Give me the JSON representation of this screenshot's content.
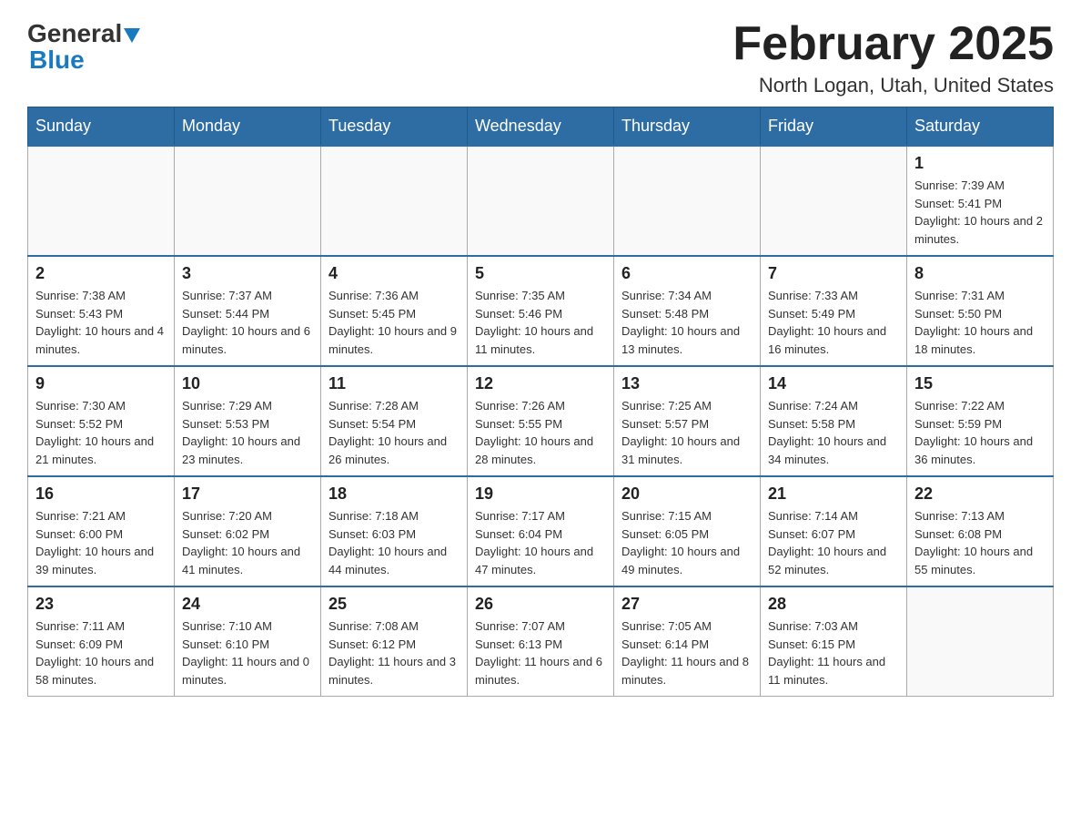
{
  "header": {
    "logo_general": "General",
    "logo_blue": "Blue",
    "month_title": "February 2025",
    "location": "North Logan, Utah, United States"
  },
  "days_of_week": [
    "Sunday",
    "Monday",
    "Tuesday",
    "Wednesday",
    "Thursday",
    "Friday",
    "Saturday"
  ],
  "weeks": [
    {
      "days": [
        {
          "number": "",
          "info": ""
        },
        {
          "number": "",
          "info": ""
        },
        {
          "number": "",
          "info": ""
        },
        {
          "number": "",
          "info": ""
        },
        {
          "number": "",
          "info": ""
        },
        {
          "number": "",
          "info": ""
        },
        {
          "number": "1",
          "info": "Sunrise: 7:39 AM\nSunset: 5:41 PM\nDaylight: 10 hours and 2 minutes."
        }
      ]
    },
    {
      "days": [
        {
          "number": "2",
          "info": "Sunrise: 7:38 AM\nSunset: 5:43 PM\nDaylight: 10 hours and 4 minutes."
        },
        {
          "number": "3",
          "info": "Sunrise: 7:37 AM\nSunset: 5:44 PM\nDaylight: 10 hours and 6 minutes."
        },
        {
          "number": "4",
          "info": "Sunrise: 7:36 AM\nSunset: 5:45 PM\nDaylight: 10 hours and 9 minutes."
        },
        {
          "number": "5",
          "info": "Sunrise: 7:35 AM\nSunset: 5:46 PM\nDaylight: 10 hours and 11 minutes."
        },
        {
          "number": "6",
          "info": "Sunrise: 7:34 AM\nSunset: 5:48 PM\nDaylight: 10 hours and 13 minutes."
        },
        {
          "number": "7",
          "info": "Sunrise: 7:33 AM\nSunset: 5:49 PM\nDaylight: 10 hours and 16 minutes."
        },
        {
          "number": "8",
          "info": "Sunrise: 7:31 AM\nSunset: 5:50 PM\nDaylight: 10 hours and 18 minutes."
        }
      ]
    },
    {
      "days": [
        {
          "number": "9",
          "info": "Sunrise: 7:30 AM\nSunset: 5:52 PM\nDaylight: 10 hours and 21 minutes."
        },
        {
          "number": "10",
          "info": "Sunrise: 7:29 AM\nSunset: 5:53 PM\nDaylight: 10 hours and 23 minutes."
        },
        {
          "number": "11",
          "info": "Sunrise: 7:28 AM\nSunset: 5:54 PM\nDaylight: 10 hours and 26 minutes."
        },
        {
          "number": "12",
          "info": "Sunrise: 7:26 AM\nSunset: 5:55 PM\nDaylight: 10 hours and 28 minutes."
        },
        {
          "number": "13",
          "info": "Sunrise: 7:25 AM\nSunset: 5:57 PM\nDaylight: 10 hours and 31 minutes."
        },
        {
          "number": "14",
          "info": "Sunrise: 7:24 AM\nSunset: 5:58 PM\nDaylight: 10 hours and 34 minutes."
        },
        {
          "number": "15",
          "info": "Sunrise: 7:22 AM\nSunset: 5:59 PM\nDaylight: 10 hours and 36 minutes."
        }
      ]
    },
    {
      "days": [
        {
          "number": "16",
          "info": "Sunrise: 7:21 AM\nSunset: 6:00 PM\nDaylight: 10 hours and 39 minutes."
        },
        {
          "number": "17",
          "info": "Sunrise: 7:20 AM\nSunset: 6:02 PM\nDaylight: 10 hours and 41 minutes."
        },
        {
          "number": "18",
          "info": "Sunrise: 7:18 AM\nSunset: 6:03 PM\nDaylight: 10 hours and 44 minutes."
        },
        {
          "number": "19",
          "info": "Sunrise: 7:17 AM\nSunset: 6:04 PM\nDaylight: 10 hours and 47 minutes."
        },
        {
          "number": "20",
          "info": "Sunrise: 7:15 AM\nSunset: 6:05 PM\nDaylight: 10 hours and 49 minutes."
        },
        {
          "number": "21",
          "info": "Sunrise: 7:14 AM\nSunset: 6:07 PM\nDaylight: 10 hours and 52 minutes."
        },
        {
          "number": "22",
          "info": "Sunrise: 7:13 AM\nSunset: 6:08 PM\nDaylight: 10 hours and 55 minutes."
        }
      ]
    },
    {
      "days": [
        {
          "number": "23",
          "info": "Sunrise: 7:11 AM\nSunset: 6:09 PM\nDaylight: 10 hours and 58 minutes."
        },
        {
          "number": "24",
          "info": "Sunrise: 7:10 AM\nSunset: 6:10 PM\nDaylight: 11 hours and 0 minutes."
        },
        {
          "number": "25",
          "info": "Sunrise: 7:08 AM\nSunset: 6:12 PM\nDaylight: 11 hours and 3 minutes."
        },
        {
          "number": "26",
          "info": "Sunrise: 7:07 AM\nSunset: 6:13 PM\nDaylight: 11 hours and 6 minutes."
        },
        {
          "number": "27",
          "info": "Sunrise: 7:05 AM\nSunset: 6:14 PM\nDaylight: 11 hours and 8 minutes."
        },
        {
          "number": "28",
          "info": "Sunrise: 7:03 AM\nSunset: 6:15 PM\nDaylight: 11 hours and 11 minutes."
        },
        {
          "number": "",
          "info": ""
        }
      ]
    }
  ]
}
